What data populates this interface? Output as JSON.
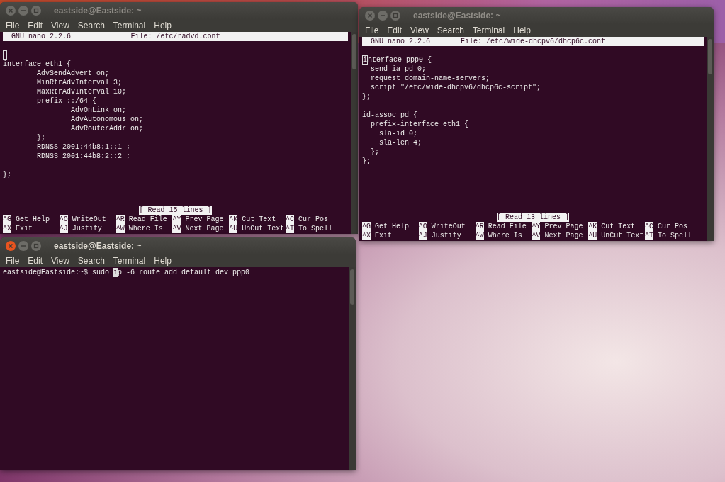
{
  "desktop": {
    "windows": [
      {
        "title": "eastside@Eastside: ~",
        "active": false,
        "menu": [
          "File",
          "Edit",
          "View",
          "Search",
          "Terminal",
          "Help"
        ],
        "nano": {
          "version": "GNU nano 2.2.6",
          "file": "File: /etc/radvd.conf",
          "lines": [
            {
              "kind": "cursor"
            },
            {
              "kind": "text",
              "text": "interface eth1 {"
            },
            {
              "kind": "text",
              "text": "        AdvSendAdvert on;"
            },
            {
              "kind": "text",
              "text": "        MinRtrAdvInterval 3;"
            },
            {
              "kind": "text",
              "text": "        MaxRtrAdvInterval 10;"
            },
            {
              "kind": "text",
              "text": "        prefix ::/64 {"
            },
            {
              "kind": "text",
              "text": "                AdvOnLink on;"
            },
            {
              "kind": "text",
              "text": "                AdvAutonomous on;"
            },
            {
              "kind": "text",
              "text": "                AdvRouterAddr on;"
            },
            {
              "kind": "text",
              "text": "        };"
            },
            {
              "kind": "text",
              "text": "        RDNSS 2001:44b8:1::1 ;"
            },
            {
              "kind": "text",
              "text": "        RDNSS 2001:44b8:2::2 ;"
            },
            {
              "kind": "blank"
            },
            {
              "kind": "text",
              "text": "};"
            }
          ],
          "status": "[ Read 15 lines ]",
          "shortcuts": [
            [
              {
                "key": "^G",
                "label": "Get Help"
              },
              {
                "key": "^O",
                "label": "WriteOut"
              },
              {
                "key": "^R",
                "label": "Read File"
              },
              {
                "key": "^Y",
                "label": "Prev Page"
              },
              {
                "key": "^K",
                "label": "Cut Text"
              },
              {
                "key": "^C",
                "label": "Cur Pos"
              }
            ],
            [
              {
                "key": "^X",
                "label": "Exit"
              },
              {
                "key": "^J",
                "label": "Justify"
              },
              {
                "key": "^W",
                "label": "Where Is"
              },
              {
                "key": "^V",
                "label": "Next Page"
              },
              {
                "key": "^U",
                "label": "UnCut Text"
              },
              {
                "key": "^T",
                "label": "To Spell"
              }
            ]
          ]
        }
      },
      {
        "title": "eastside@Eastside: ~",
        "active": false,
        "menu": [
          "File",
          "Edit",
          "View",
          "Search",
          "Terminal",
          "Help"
        ],
        "nano": {
          "version": "GNU nano 2.2.6",
          "file": "File: /etc/wide-dhcpv6/dhcp6c.conf",
          "lines": [
            {
              "kind": "cursor",
              "cursor": "i",
              "text": "nterface ppp0 {"
            },
            {
              "kind": "text",
              "text": "  send ia-pd 0;"
            },
            {
              "kind": "text",
              "text": "  request domain-name-servers;"
            },
            {
              "kind": "text",
              "text": "  script \"/etc/wide-dhcpv6/dhcp6c-script\";"
            },
            {
              "kind": "text",
              "text": "};"
            },
            {
              "kind": "blank"
            },
            {
              "kind": "text",
              "text": "id-assoc pd {"
            },
            {
              "kind": "text",
              "text": "  prefix-interface eth1 {"
            },
            {
              "kind": "text",
              "text": "    sla-id 0;"
            },
            {
              "kind": "text",
              "text": "    sla-len 4;"
            },
            {
              "kind": "text",
              "text": "  };"
            },
            {
              "kind": "text",
              "text": "};"
            }
          ],
          "status": "[ Read 13 lines ]",
          "shortcuts": [
            [
              {
                "key": "^G",
                "label": "Get Help"
              },
              {
                "key": "^O",
                "label": "WriteOut"
              },
              {
                "key": "^R",
                "label": "Read File"
              },
              {
                "key": "^Y",
                "label": "Prev Page"
              },
              {
                "key": "^K",
                "label": "Cut Text"
              },
              {
                "key": "^C",
                "label": "Cur Pos"
              }
            ],
            [
              {
                "key": "^X",
                "label": "Exit"
              },
              {
                "key": "^J",
                "label": "Justify"
              },
              {
                "key": "^W",
                "label": "Where Is"
              },
              {
                "key": "^V",
                "label": "Next Page"
              },
              {
                "key": "^U",
                "label": "UnCut Text"
              },
              {
                "key": "^T",
                "label": "To Spell"
              }
            ]
          ]
        }
      },
      {
        "title": "eastside@Eastside: ~",
        "active": true,
        "menu": [
          "File",
          "Edit",
          "View",
          "Search",
          "Terminal",
          "Help"
        ],
        "shell": {
          "lines": [
            {
              "kind": "cursor",
              "before": "eastside@Eastside:~$ sudo ",
              "cursor": "i",
              "text": "p -6 route add default dev ppp0"
            }
          ]
        }
      }
    ]
  }
}
